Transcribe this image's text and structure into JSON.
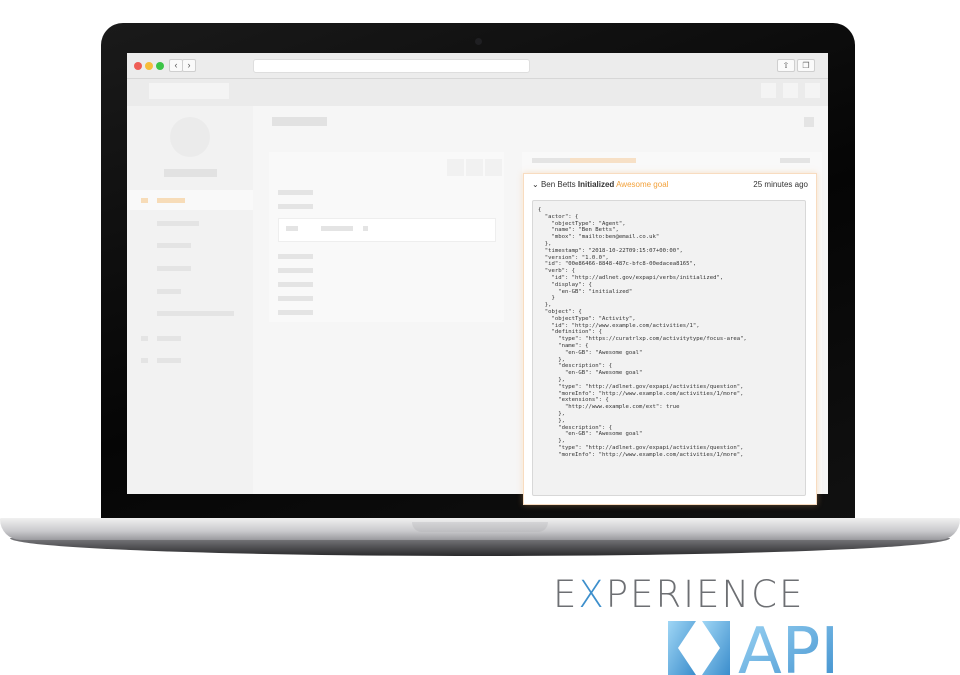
{
  "logo": {
    "word_prefix": "E",
    "word_x": "X",
    "word_rest": "PERIENCE",
    "api_text": "API",
    "colors": {
      "gray": "#6d6f73",
      "blue": "#3d8fcc",
      "blue_light": "#7fc3ee"
    }
  },
  "browser": {
    "back": "‹",
    "forward": "›",
    "url": "",
    "traffic_colors": {
      "close": "#ee5d55",
      "minimize": "#f6bd3a",
      "maximize": "#3cc447"
    }
  },
  "statement": {
    "actor": "Ben Betts",
    "verb": "Initialized",
    "object": "Awesome goal",
    "time": "25 minutes ago",
    "json": "{\n  \"actor\": {\n    \"objectType\": \"Agent\",\n    \"name\": \"Ben Betts\",\n    \"mbox\": \"mailto:ben@email.co.uk\"\n  },\n  \"timestamp\": \"2018-10-22T09:15:07+00:00\",\n  \"version\": \"1.0.0\",\n  \"id\": \"00e86466-8848-487c-bfc8-00edacea8165\",\n  \"verb\": {\n    \"id\": \"http://adlnet.gov/expapi/verbs/initialized\",\n    \"display\": {\n      \"en-GB\": \"initialized\"\n    }\n  },\n  \"object\": {\n    \"objectType\": \"Activity\",\n    \"id\": \"http://www.example.com/activities/1\",\n    \"definition\": {\n      \"type\": \"https://curatrlxp.com/activitytype/focus-area\",\n      \"name\": {\n        \"en-GB\": \"Awesome goal\"\n      },\n      \"description\": {\n        \"en-GB\": \"Awesome goal\"\n      },\n      \"type\": \"http://adlnet.gov/expapi/activities/question\",\n      \"moreInfo\": \"http://www.example.com/activities/1/more\",\n      \"extensions\": {\n        \"http://www.example.com/ext\": true\n      },\n      },\n      \"description\": {\n        \"en-GB\": \"Awesome goal\"\n      },\n      \"type\": \"http://adlnet.gov/expapi/activities/question\",\n      \"moreInfo\": \"http://www.example.com/activities/1/more\","
  }
}
